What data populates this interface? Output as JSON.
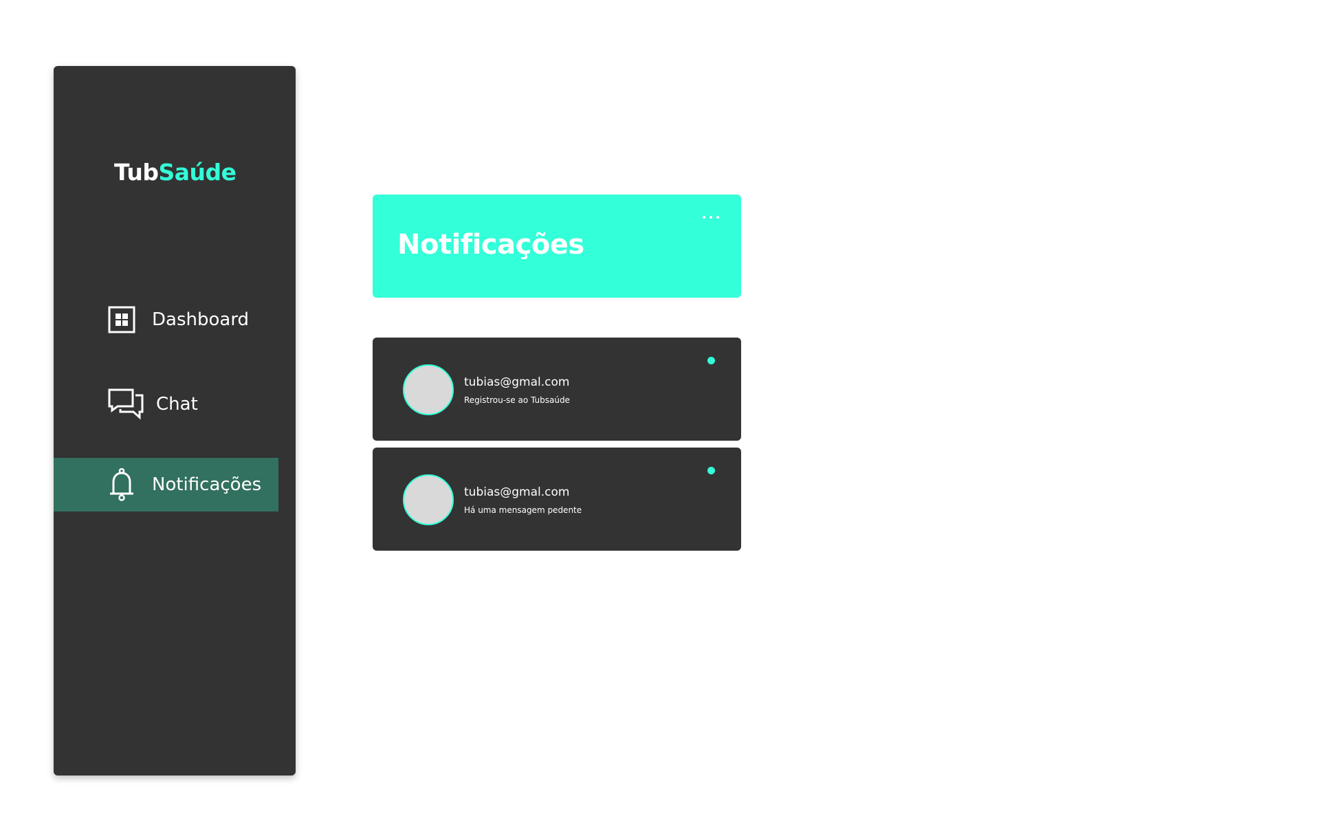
{
  "app": {
    "logo_part1": "Tub",
    "logo_part2": "Saúde"
  },
  "sidebar": {
    "items": [
      {
        "label": "Dashboard",
        "icon": "dashboard-grid-icon",
        "active": false
      },
      {
        "label": "Chat",
        "icon": "chat-bubbles-icon",
        "active": false
      },
      {
        "label": "Notificações",
        "icon": "bell-icon",
        "active": true
      }
    ]
  },
  "header": {
    "title": "Notificações",
    "more_icon": "more-horizontal-icon"
  },
  "notifications": [
    {
      "email": "tubias@gmal.com",
      "message": "Registrou-se ao Tubsaúde",
      "unread": true
    },
    {
      "email": "tubias@gmal.com",
      "message": "Há uma mensagem pedente",
      "unread": true
    }
  ],
  "colors": {
    "accent": "#33ffd8",
    "sidebar_bg": "#333333",
    "active_item_bg": "#32705f",
    "card_bg": "#333333",
    "avatar_bg": "#d9d9d9",
    "text": "#ffffff"
  }
}
